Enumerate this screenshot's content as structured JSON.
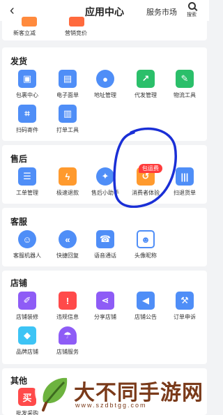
{
  "header": {
    "back": "‹",
    "title": "应用中心",
    "market": "服务市场",
    "search_label": "搜索"
  },
  "top_strip": {
    "item1": "新客立减",
    "item2": "营销竞价"
  },
  "fahuo": {
    "title": "发货",
    "items": [
      "包裹中心",
      "电子面单",
      "地址管理",
      "代发管理",
      "物流工具",
      "扫码寄件",
      "打单工具"
    ]
  },
  "shouhou": {
    "title": "售后",
    "items": [
      "工单管理",
      "极速退款",
      "售后小助手",
      "消费者体验",
      "扫退货单"
    ],
    "badge": "包运费"
  },
  "kefu": {
    "title": "客服",
    "items": [
      "客服机器人",
      "快捷回复",
      "语音通话",
      "头像昵称"
    ]
  },
  "dianpu": {
    "title": "店铺",
    "items": [
      "店铺装修",
      "违规信息",
      "分享店铺",
      "店铺公告",
      "订单申诉",
      "品牌店铺",
      "店铺服务"
    ]
  },
  "qita": {
    "title": "其他",
    "items": [
      "批发采购"
    ]
  },
  "watermark": {
    "brand": "大不同手游网",
    "url": "www.szdbtgg.com"
  },
  "colors": {
    "blue": "#3d7df5",
    "orange": "#ff9a2e",
    "red": "#ff4a4a",
    "purple": "#8e5cf6",
    "green": "#2bbf6a",
    "annotation": "#1a2fd6"
  }
}
